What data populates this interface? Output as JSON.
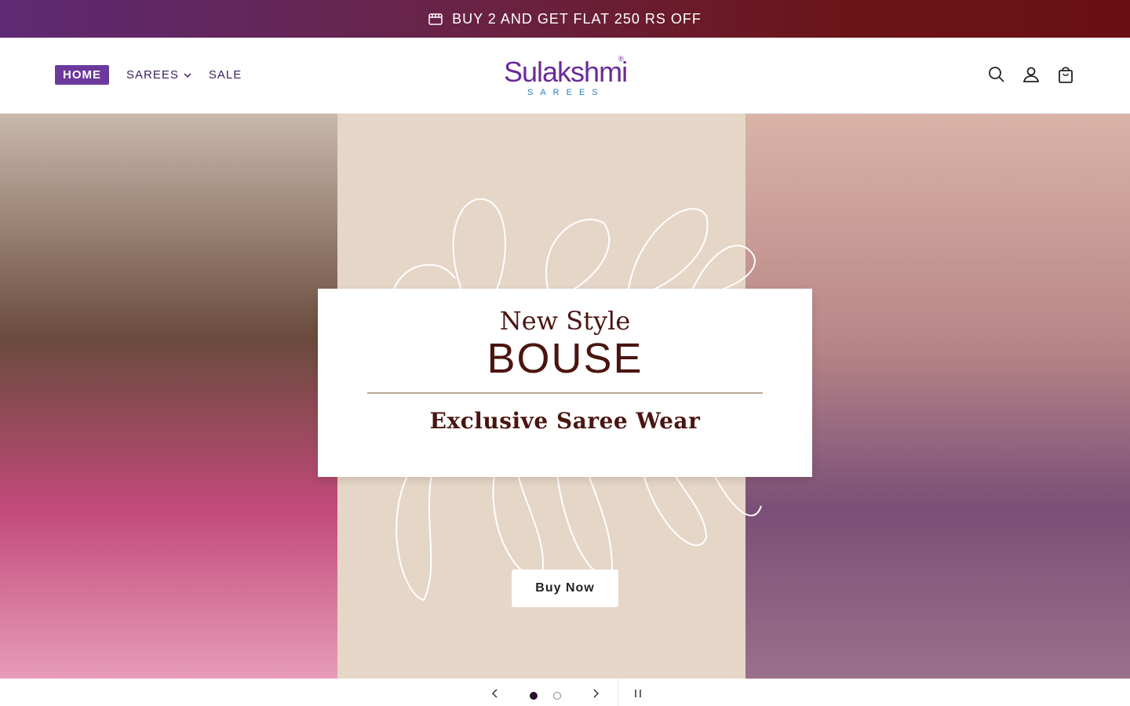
{
  "announcement": {
    "icon": "store-icon",
    "text": "BUY 2 AND GET FLAT 250 RS OFF"
  },
  "nav": {
    "items": [
      {
        "label": "HOME"
      },
      {
        "label": "SAREES",
        "icon": "chevron-down-icon"
      },
      {
        "label": "SALE"
      }
    ]
  },
  "logo": {
    "brand": "Sulakshmi",
    "sub": "SAREES",
    "reg": "®"
  },
  "header_icons": [
    "search-icon",
    "account-icon",
    "cart-icon"
  ],
  "hero": {
    "line1": "New Style",
    "line2": "BOUSE",
    "line3": "Exclusive Saree Wear",
    "cta": "Buy Now"
  },
  "slider": {
    "prev_icon": "chevron-left-icon",
    "next_icon": "chevron-right-icon",
    "pause_icon": "pause-icon",
    "slides": 2,
    "active": 1
  },
  "colors": {
    "brand": "#6b2a99",
    "accent": "#6b3a9c",
    "cta_text": "#222222"
  }
}
